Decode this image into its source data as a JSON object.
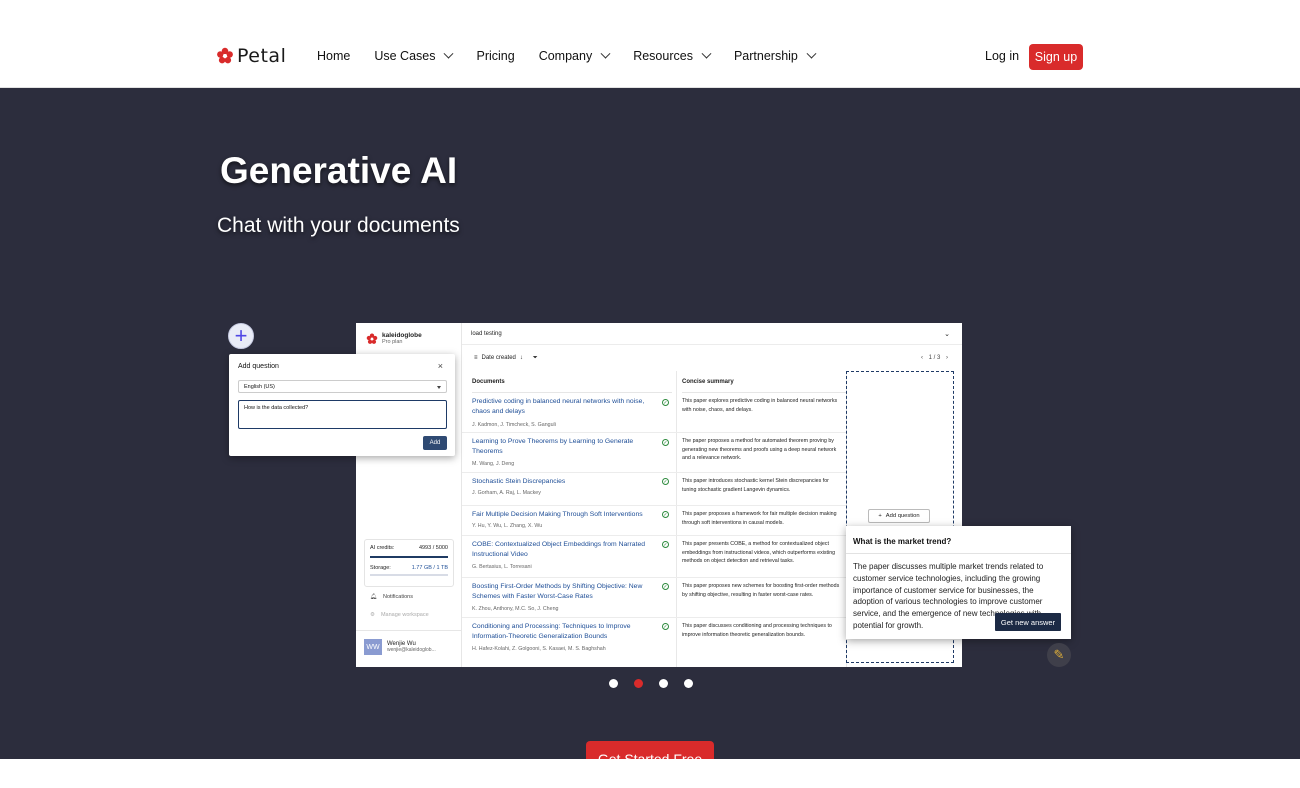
{
  "brand": {
    "name": "Petal",
    "accent": "#d92b2b"
  },
  "nav": {
    "items": [
      {
        "label": "Home",
        "has_menu": false
      },
      {
        "label": "Use Cases",
        "has_menu": true
      },
      {
        "label": "Pricing",
        "has_menu": false
      },
      {
        "label": "Company",
        "has_menu": true
      },
      {
        "label": "Resources",
        "has_menu": true
      },
      {
        "label": "Partnership",
        "has_menu": true
      }
    ],
    "login": "Log in",
    "signup": "Sign up"
  },
  "hero": {
    "title": "Generative AI",
    "subtitle": "Chat with your documents",
    "background": "#2c2d3d",
    "cta": "Get Started Free"
  },
  "app": {
    "workspace": {
      "name": "kaleidoglobe",
      "plan": "Pro plan"
    },
    "search": "load testing",
    "sort_label": "Date created",
    "pager": "1 / 3",
    "columns": {
      "documents": "Documents",
      "summary": "Concise summary"
    },
    "rows": [
      {
        "title": "Predictive coding in balanced neural networks with noise, chaos and delays",
        "authors": "J. Kadmon, J. Timcheck, S. Ganguli",
        "summary": "This paper explores predictive coding in balanced neural networks with noise, chaos, and delays."
      },
      {
        "title": "Learning to Prove Theorems by Learning to Generate Theorems",
        "authors": "M. Wang, J. Deng",
        "summary": "The paper proposes a method for automated theorem proving by generating new theorems and proofs using a deep neural network and a relevance network."
      },
      {
        "title": "Stochastic Stein Discrepancies",
        "authors": "J. Gorham, A. Raj, L. Mackey",
        "summary": "This paper introduces stochastic kernel Stein discrepancies for tuning stochastic gradient Langevin dynamics."
      },
      {
        "title": "Fair Multiple Decision Making Through Soft Interventions",
        "authors": "Y. Hu, Y. Wu, L. Zhang, X. Wu",
        "summary": "This paper proposes a framework for fair multiple decision making through soft interventions in causal models."
      },
      {
        "title": "COBE: Contextualized Object Embeddings from Narrated Instructional Video",
        "authors": "G. Bertasius, L. Torresani",
        "summary": "This paper presents COBE, a method for contextualized object embeddings from instructional videos, which outperforms existing methods on object detection and retrieval tasks."
      },
      {
        "title": "Boosting First-Order Methods by Shifting Objective: New Schemes with Faster Worst-Case Rates",
        "authors": "K. Zhou, Anthony, M.C. So, J. Cheng",
        "summary": "This paper proposes new schemes for boosting first-order methods by shifting objective, resulting in faster worst-case rates."
      },
      {
        "title": "Conditioning and Processing: Techniques to Improve Information-Theoretic Generalization Bounds",
        "authors": "H. Hafez-Kolahi, Z. Golgooni, S. Kasaei, M. S. Baghshah",
        "summary": "This paper discusses conditioning and processing techniques to improve information theoretic generalization bounds."
      }
    ],
    "add_question": "Add question",
    "credits": {
      "label": "AI credits:",
      "value": "4993 / 5000"
    },
    "storage": {
      "label": "Storage:",
      "value": "1.77 GB / 1 TB"
    },
    "notifications": "Notifications",
    "manage": "Manage workspace",
    "user": {
      "initials": "WW",
      "name": "Wenjie Wu",
      "email": "wenjie@kaleidoglob..."
    }
  },
  "add_panel": {
    "title": "Add question",
    "language": "English (US)",
    "question": "How is the data collected?",
    "button": "Add"
  },
  "answer_panel": {
    "question": "What is the market trend?",
    "answer": "The paper discusses multiple market trends related to customer service technologies, including the growing importance of customer service for businesses, the adoption of various technologies to improve customer service, and the emergence of new technologies with potential for growth.",
    "button": "Get new answer"
  },
  "carousel": {
    "count": 4,
    "active": 2
  }
}
